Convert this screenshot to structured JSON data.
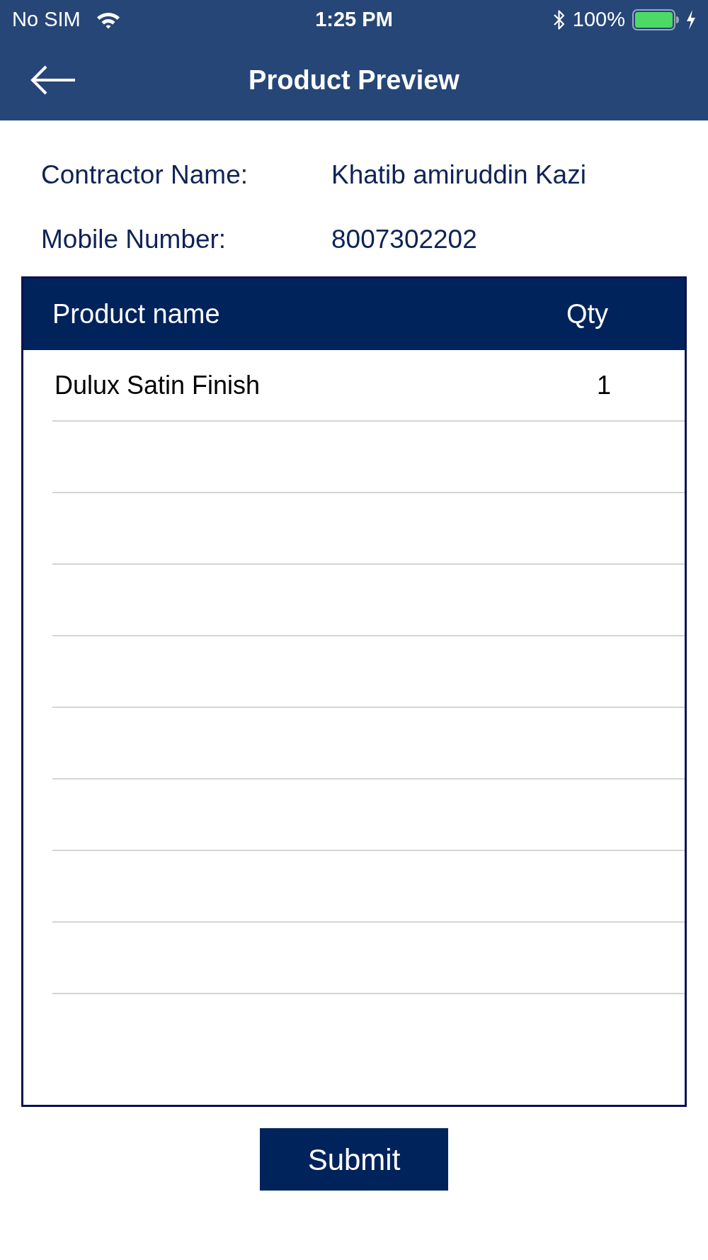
{
  "status_bar": {
    "carrier": "No SIM",
    "time": "1:25 PM",
    "battery": "100%"
  },
  "header": {
    "title": "Product Preview"
  },
  "details": [
    {
      "label": "Contractor Name:",
      "value": "Khatib amiruddin Kazi"
    },
    {
      "label": "Mobile Number:",
      "value": "8007302202"
    }
  ],
  "table": {
    "columns": [
      "Product name",
      "Qty"
    ],
    "rows": [
      [
        "Dulux Satin Finish",
        "1"
      ]
    ]
  },
  "submit_button": {
    "label": "Submit"
  }
}
